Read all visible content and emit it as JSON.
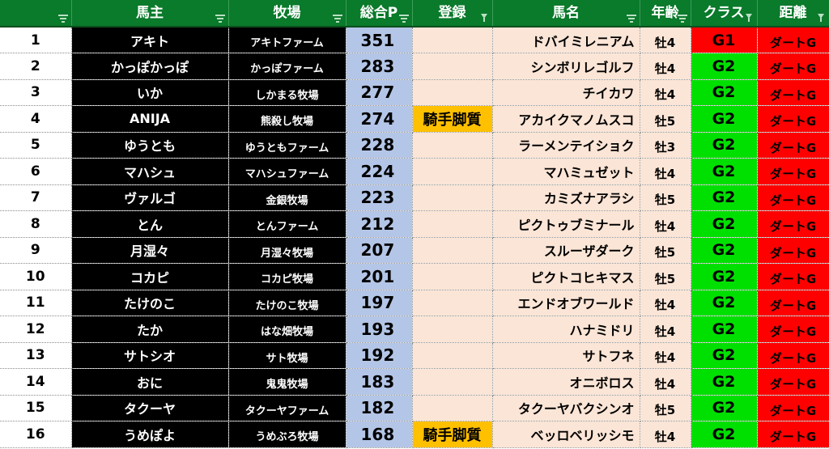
{
  "header": {
    "columns": [
      {
        "label": "",
        "filter": "sort"
      },
      {
        "label": "馬主",
        "filter": "sort"
      },
      {
        "label": "牧場",
        "filter": "sort"
      },
      {
        "label": "総合P",
        "filter": "sort"
      },
      {
        "label": "登録",
        "filter": "funnel"
      },
      {
        "label": "馬名",
        "filter": "sort"
      },
      {
        "label": "年齢",
        "filter": "sort"
      },
      {
        "label": "クラス",
        "filter": "funnel"
      },
      {
        "label": "距離",
        "filter": "funnel"
      }
    ]
  },
  "rows": [
    {
      "rank": "1",
      "owner": "アキト",
      "ranch": "アキトファーム",
      "points": "351",
      "registration": "",
      "horse": "ドバイミレニアム",
      "age": "牡4",
      "class": "G1",
      "distance": "ダートG"
    },
    {
      "rank": "2",
      "owner": "かっぽかっぽ",
      "ranch": "かっぽファーム",
      "points": "283",
      "registration": "",
      "horse": "シンボリレゴルフ",
      "age": "牡4",
      "class": "G2",
      "distance": "ダートG"
    },
    {
      "rank": "3",
      "owner": "いか",
      "ranch": "しかまる牧場",
      "points": "277",
      "registration": "",
      "horse": "チイカワ",
      "age": "牡4",
      "class": "G2",
      "distance": "ダートG"
    },
    {
      "rank": "4",
      "owner": "ANIJA",
      "ranch": "熊殺し牧場",
      "points": "274",
      "registration": "騎手脚質",
      "horse": "アカイクマノムスコ",
      "age": "牡5",
      "class": "G2",
      "distance": "ダートG"
    },
    {
      "rank": "5",
      "owner": "ゆうとも",
      "ranch": "ゆうともファーム",
      "points": "228",
      "registration": "",
      "horse": "ラーメンテイショク",
      "age": "牡3",
      "class": "G2",
      "distance": "ダートG"
    },
    {
      "rank": "6",
      "owner": "マハシュ",
      "ranch": "マハシュファーム",
      "points": "224",
      "registration": "",
      "horse": "マハミュゼット",
      "age": "牡4",
      "class": "G2",
      "distance": "ダートG"
    },
    {
      "rank": "7",
      "owner": "ヴァルゴ",
      "ranch": "金銀牧場",
      "points": "223",
      "registration": "",
      "horse": "カミズナアラシ",
      "age": "牡5",
      "class": "G2",
      "distance": "ダートG"
    },
    {
      "rank": "8",
      "owner": "とん",
      "ranch": "とんファーム",
      "points": "212",
      "registration": "",
      "horse": "ピクトゥブミナール",
      "age": "牡4",
      "class": "G2",
      "distance": "ダートG"
    },
    {
      "rank": "9",
      "owner": "月湿々",
      "ranch": "月湿々牧場",
      "points": "207",
      "registration": "",
      "horse": "スルーザダーク",
      "age": "牡5",
      "class": "G2",
      "distance": "ダートG"
    },
    {
      "rank": "10",
      "owner": "コカピ",
      "ranch": "コカピ牧場",
      "points": "201",
      "registration": "",
      "horse": "ピクトコヒキマス",
      "age": "牡5",
      "class": "G2",
      "distance": "ダートG"
    },
    {
      "rank": "11",
      "owner": "たけのこ",
      "ranch": "たけのこ牧場",
      "points": "197",
      "registration": "",
      "horse": "エンドオブワールド",
      "age": "牡4",
      "class": "G2",
      "distance": "ダートG"
    },
    {
      "rank": "12",
      "owner": "たか",
      "ranch": "はな畑牧場",
      "points": "193",
      "registration": "",
      "horse": "ハナミドリ",
      "age": "牡4",
      "class": "G2",
      "distance": "ダートG"
    },
    {
      "rank": "13",
      "owner": "サトシオ",
      "ranch": "サト牧場",
      "points": "192",
      "registration": "",
      "horse": "サトフネ",
      "age": "牡4",
      "class": "G2",
      "distance": "ダートG"
    },
    {
      "rank": "14",
      "owner": "おに",
      "ranch": "鬼鬼牧場",
      "points": "183",
      "registration": "",
      "horse": "オニボロス",
      "age": "牡4",
      "class": "G2",
      "distance": "ダートG"
    },
    {
      "rank": "15",
      "owner": "タクーヤ",
      "ranch": "タクーヤファーム",
      "points": "182",
      "registration": "",
      "horse": "タクーヤバクシンオ",
      "age": "牡5",
      "class": "G2",
      "distance": "ダートG"
    },
    {
      "rank": "16",
      "owner": "うめぽよ",
      "ranch": "うめぶろ牧場",
      "points": "168",
      "registration": "騎手脚質",
      "horse": "ベッロベリッシモ",
      "age": "牡4",
      "class": "G2",
      "distance": "ダートG"
    }
  ],
  "colors": {
    "header": "#0a7a2b",
    "owner_bg": "#000000",
    "points_bg": "#b4c6e7",
    "entry_bg": "#fbe5d6",
    "tag_bg": "#ffc000",
    "g1": "#ff0000",
    "g2": "#00e000",
    "distance": "#ff0000"
  }
}
